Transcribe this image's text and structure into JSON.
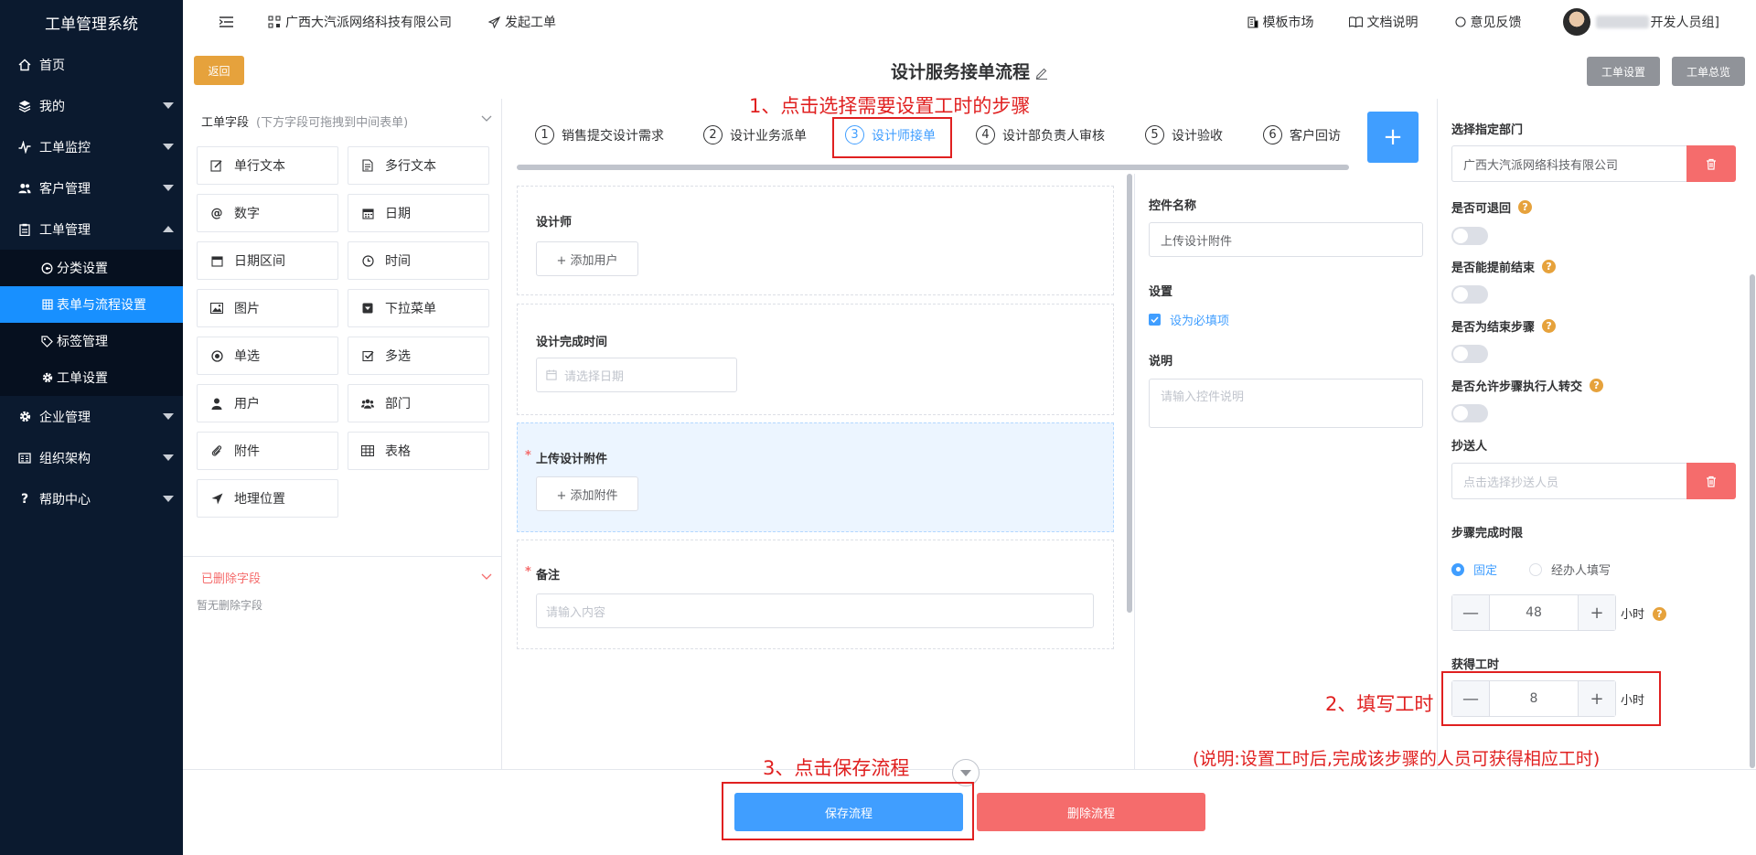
{
  "app": {
    "title": "工单管理系统"
  },
  "sidebar": {
    "items": [
      {
        "label": "首页",
        "icon": "home-icon"
      },
      {
        "label": "我的",
        "icon": "layers-icon"
      },
      {
        "label": "工单监控",
        "icon": "pulse-icon"
      },
      {
        "label": "客户管理",
        "icon": "users-icon"
      },
      {
        "label": "工单管理",
        "icon": "clipboard-icon"
      },
      {
        "label": "企业管理",
        "icon": "gear-icon"
      },
      {
        "label": "组织架构",
        "icon": "org-icon"
      },
      {
        "label": "帮助中心",
        "icon": "question-icon"
      }
    ],
    "sub": [
      {
        "label": "分类设置",
        "icon": "category-icon"
      },
      {
        "label": "表单与流程设置",
        "icon": "grid-icon"
      },
      {
        "label": "标签管理",
        "icon": "tag-icon"
      },
      {
        "label": "工单设置",
        "icon": "gear-icon"
      }
    ]
  },
  "header": {
    "company": "广西大汽派网络科技有限公司",
    "start_ticket": "发起工单",
    "template_market": "模板市场",
    "docs": "文档说明",
    "feedback": "意见反馈",
    "user_suffix": "开发人员组]"
  },
  "titlebar": {
    "back": "返回",
    "title": "设计服务接单流程",
    "ticket_settings": "工单设置",
    "ticket_overview": "工单总览"
  },
  "fields_panel": {
    "title": "工单字段",
    "hint": "(下方字段可拖拽到中间表单)",
    "fields": [
      {
        "label": "单行文本",
        "icon": "edit-icon"
      },
      {
        "label": "多行文本",
        "icon": "document-icon"
      },
      {
        "label": "数字",
        "icon": "at-icon"
      },
      {
        "label": "日期",
        "icon": "calendar-icon"
      },
      {
        "label": "日期区间",
        "icon": "calendar-range-icon"
      },
      {
        "label": "时间",
        "icon": "clock-icon"
      },
      {
        "label": "图片",
        "icon": "image-icon"
      },
      {
        "label": "下拉菜单",
        "icon": "dropdown-icon"
      },
      {
        "label": "单选",
        "icon": "radio-icon"
      },
      {
        "label": "多选",
        "icon": "checkbox-icon"
      },
      {
        "label": "用户",
        "icon": "user-icon"
      },
      {
        "label": "部门",
        "icon": "group-icon"
      },
      {
        "label": "附件",
        "icon": "paperclip-icon"
      },
      {
        "label": "表格",
        "icon": "table-icon"
      },
      {
        "label": "地理位置",
        "icon": "location-icon"
      }
    ],
    "deleted_title": "已删除字段",
    "deleted_empty": "暂无删除字段"
  },
  "steps": [
    {
      "num": "1",
      "label": "销售提交设计需求"
    },
    {
      "num": "2",
      "label": "设计业务派单"
    },
    {
      "num": "3",
      "label": "设计师接单"
    },
    {
      "num": "4",
      "label": "设计部负责人审核"
    },
    {
      "num": "5",
      "label": "设计验收"
    },
    {
      "num": "6",
      "label": "客户回访"
    }
  ],
  "add_step": "+",
  "form": {
    "designer_label": "设计师",
    "add_user": "+ 添加用户",
    "finish_time_label": "设计完成时间",
    "date_placeholder": "请选择日期",
    "upload_label": "上传设计附件",
    "add_attachment": "+ 添加附件",
    "remark_label": "备注",
    "remark_placeholder": "请输入内容",
    "required_mark": "*"
  },
  "props": {
    "name_label": "控件名称",
    "name_value": "上传设计附件",
    "settings_label": "设置",
    "required_option": "设为必填项",
    "desc_label": "说明",
    "desc_placeholder": "请输入控件说明"
  },
  "step_settings": {
    "dept_label": "选择指定部门",
    "dept_value": "广西大汽派网络科技有限公司",
    "can_return": "是否可退回",
    "can_finish_early": "是否能提前结束",
    "is_end_step": "是否为结束步骤",
    "allow_transfer": "是否允许步骤执行人转交",
    "cc_label": "抄送人",
    "cc_placeholder": "点击选择抄送人员",
    "deadline_label": "步骤完成时限",
    "fixed": "固定",
    "handler_fill": "经办人填写",
    "deadline_value": "48",
    "hours": "小时",
    "work_hours_label": "获得工时",
    "work_hours_value": "8",
    "minus": "—",
    "plus": "+",
    "q": "?"
  },
  "footer": {
    "save": "保存流程",
    "delete": "删除流程"
  },
  "annotations": {
    "a1": "1、点击选择需要设置工时的步骤",
    "a2": "2、填写工时",
    "a3": "3、点击保存流程",
    "note": "(说明:设置工时后,完成该步骤的人员可获得相应工时)"
  },
  "colors": {
    "sidebar_bg": "#0b1a2f",
    "primary": "#409eff",
    "danger": "#f56c6c",
    "warning": "#e6a23c",
    "annotation": "#e02020"
  }
}
